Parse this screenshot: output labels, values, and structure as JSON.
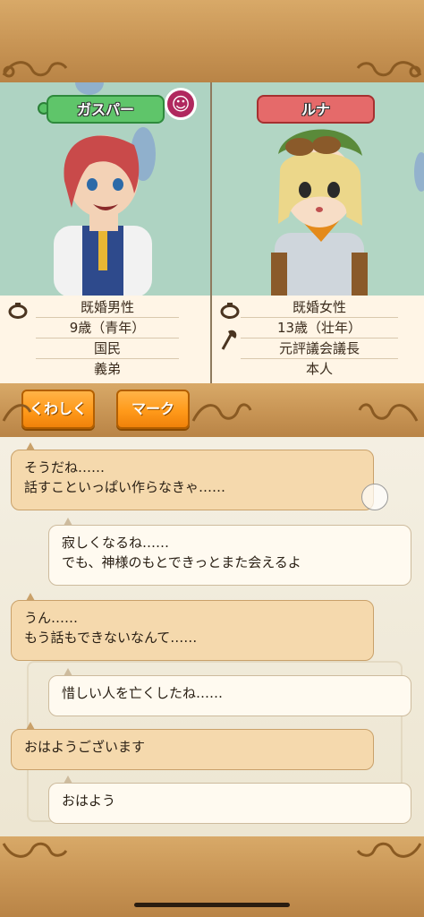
{
  "characters": [
    {
      "name": "ガスパー",
      "tag_color": "#5fc56a",
      "mood_icon": "smiley-icon",
      "info": [
        "既婚男性",
        "9歳（青年）",
        "国民",
        "義弟"
      ]
    },
    {
      "name": "ルナ",
      "tag_color": "#e56a6a",
      "info": [
        "既婚女性",
        "13歳（壮年）",
        "元評議会議長",
        "本人"
      ]
    }
  ],
  "buttons": {
    "detail": "くわしく",
    "mark": "マーク"
  },
  "chat": [
    {
      "side": "left",
      "text": "そうだね……\n話すこといっぱい作らなきゃ……"
    },
    {
      "side": "right",
      "text": "寂しくなるね……\nでも、神様のもとできっとまた会えるよ"
    },
    {
      "side": "left",
      "text": "うん……\nもう話もできないなんて……"
    },
    {
      "side": "right",
      "text": "惜しい人を亡くしたね……"
    },
    {
      "side": "left",
      "text": "おはようございます"
    },
    {
      "side": "right",
      "text": "おはよう"
    }
  ]
}
